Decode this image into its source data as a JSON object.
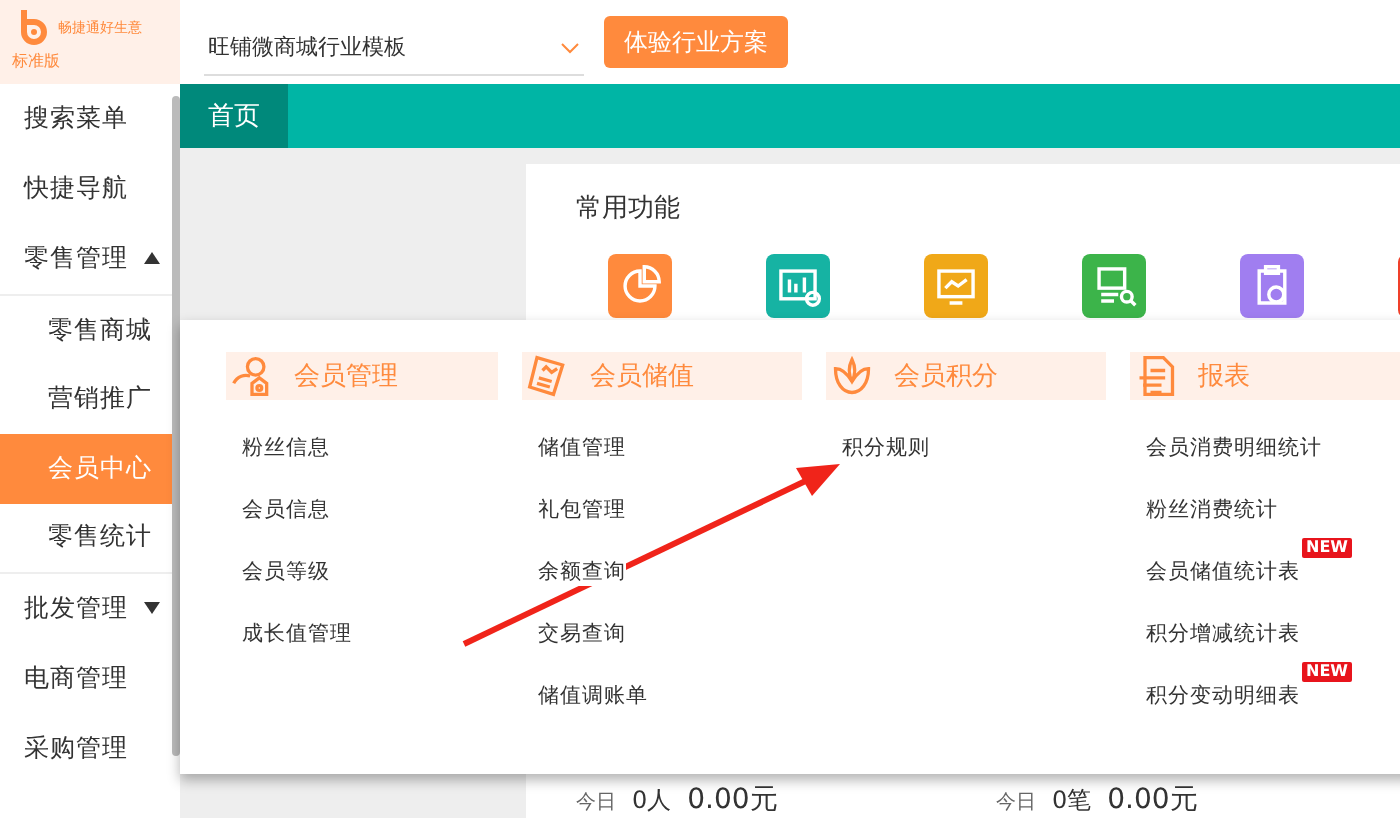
{
  "header": {
    "logo": {
      "brand": "畅捷通好生意",
      "edition": "标准版"
    },
    "template_select": {
      "value": "旺铺微商城行业模板"
    },
    "trial_button": "体验行业方案"
  },
  "sidebar": {
    "items": [
      {
        "label": "搜索菜单",
        "selected": false
      },
      {
        "label": "快捷导航",
        "selected": false
      },
      {
        "label": "零售管理",
        "selected": false,
        "expanded": true,
        "children": [
          {
            "label": "零售商城",
            "selected": false
          },
          {
            "label": "营销推广",
            "selected": false
          },
          {
            "label": "会员中心",
            "selected": true
          },
          {
            "label": "零售统计",
            "selected": false
          }
        ]
      },
      {
        "label": "批发管理",
        "selected": false,
        "expanded": false
      },
      {
        "label": "电商管理",
        "selected": false
      },
      {
        "label": "采购管理",
        "selected": false
      }
    ]
  },
  "tabs": [
    {
      "label": "首页",
      "selected": true
    }
  ],
  "common_functions": {
    "title": "常用功能",
    "shortcuts": [
      {
        "kind": "pie",
        "color": "#ff8a3d"
      },
      {
        "kind": "bars",
        "color": "#16b3a3"
      },
      {
        "kind": "monitor",
        "color": "#f0a818"
      },
      {
        "kind": "search",
        "color": "#3cb44a"
      },
      {
        "kind": "clipboard",
        "color": "#a07ef0"
      },
      {
        "kind": "other",
        "color": "#f0402a"
      }
    ]
  },
  "stats": [
    {
      "label": "今日",
      "count": "0人",
      "amount": "0.00元"
    },
    {
      "label": "今日",
      "count": "0笔",
      "amount": "0.00元"
    }
  ],
  "menu_panel": {
    "columns": [
      {
        "kind": "member",
        "title": "会员管理",
        "items": [
          {
            "label": "粉丝信息"
          },
          {
            "label": "会员信息"
          },
          {
            "label": "会员等级"
          },
          {
            "label": "成长值管理"
          }
        ]
      },
      {
        "kind": "stored_value",
        "title": "会员储值",
        "items": [
          {
            "label": "储值管理"
          },
          {
            "label": "礼包管理"
          },
          {
            "label": "余额查询"
          },
          {
            "label": "交易查询"
          },
          {
            "label": "储值调账单"
          }
        ]
      },
      {
        "kind": "points",
        "title": "会员积分",
        "items": [
          {
            "label": "积分规则"
          }
        ]
      },
      {
        "kind": "report",
        "title": "报表",
        "items": [
          {
            "label": "会员消费明细统计"
          },
          {
            "label": "粉丝消费统计"
          },
          {
            "label": "会员储值统计表",
            "badge": "NEW"
          },
          {
            "label": "积分增减统计表"
          },
          {
            "label": "积分变动明细表",
            "badge": "NEW"
          }
        ]
      }
    ]
  }
}
